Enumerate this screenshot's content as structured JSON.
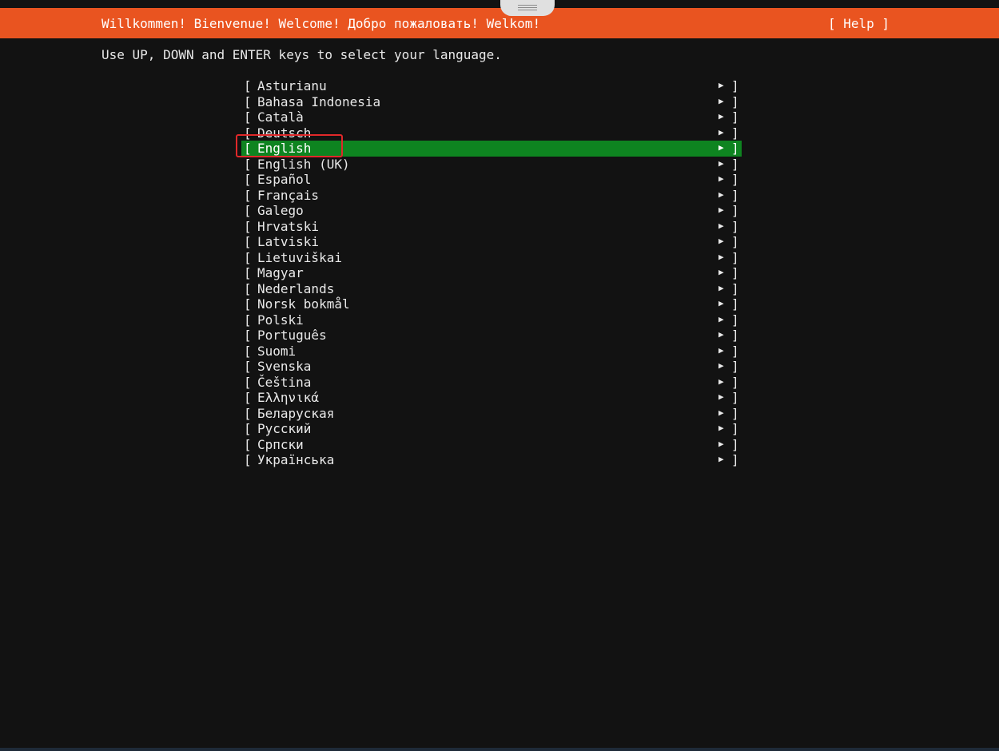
{
  "header": {
    "title": "Willkommen! Bienvenue! Welcome! Добро пожаловать! Welkom!",
    "help_label": "[ Help ]"
  },
  "instruction": "Use UP, DOWN and ENTER keys to select your language.",
  "list": {
    "bracket_open": "[",
    "bracket_close": "]",
    "arrow": "▶",
    "selected_label": "English",
    "items": [
      {
        "label": "Asturianu"
      },
      {
        "label": "Bahasa Indonesia"
      },
      {
        "label": "Català"
      },
      {
        "label": "Deutsch"
      },
      {
        "label": "English"
      },
      {
        "label": "English (UK)"
      },
      {
        "label": "Español"
      },
      {
        "label": "Français"
      },
      {
        "label": "Galego"
      },
      {
        "label": "Hrvatski"
      },
      {
        "label": "Latviski"
      },
      {
        "label": "Lietuviškai"
      },
      {
        "label": "Magyar"
      },
      {
        "label": "Nederlands"
      },
      {
        "label": "Norsk bokmål"
      },
      {
        "label": "Polski"
      },
      {
        "label": "Português"
      },
      {
        "label": "Suomi"
      },
      {
        "label": "Svenska"
      },
      {
        "label": "Čeština"
      },
      {
        "label": "Ελληνικά"
      },
      {
        "label": "Беларуская"
      },
      {
        "label": "Русский"
      },
      {
        "label": "Српски"
      },
      {
        "label": "Українська"
      }
    ]
  },
  "colors": {
    "header_bg": "#e95420",
    "selected_bg": "#0e8420",
    "background": "#121212",
    "annotation_box": "#e0282a"
  }
}
